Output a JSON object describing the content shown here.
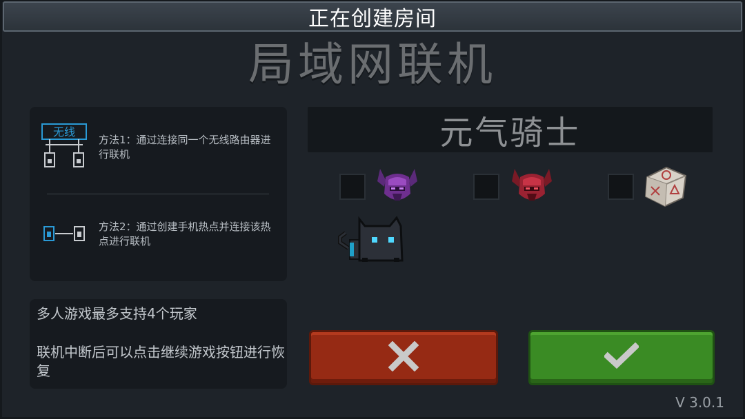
{
  "title_bar": {
    "text": "正在创建房间"
  },
  "heading": "局域网联机",
  "methods": [
    {
      "icon": "wifi-router-icon",
      "text": "方法1：通过连接同一个无线路由器进行联机",
      "icon_label": "无线"
    },
    {
      "icon": "hotspot-icon",
      "text": "方法2：通过创建手机热点并连接该热点进行联机"
    }
  ],
  "tips": [
    "多人游戏最多支持4个玩家",
    "联机中断后可以点击继续游戏按钮进行恢复"
  ],
  "game_name": "元气骑士",
  "options": [
    {
      "checked": false,
      "icon": "purple-horned-helmet-icon"
    },
    {
      "checked": false,
      "icon": "red-horned-helmet-icon"
    },
    {
      "checked": false,
      "icon": "dice-icon"
    }
  ],
  "player_avatar": {
    "icon": "black-cat-icon"
  },
  "buttons": {
    "cancel": {
      "icon": "x-icon",
      "color": "#962a14"
    },
    "confirm": {
      "icon": "checkmark-icon",
      "color": "#3a8b24"
    }
  },
  "version": "V 3.0.1"
}
